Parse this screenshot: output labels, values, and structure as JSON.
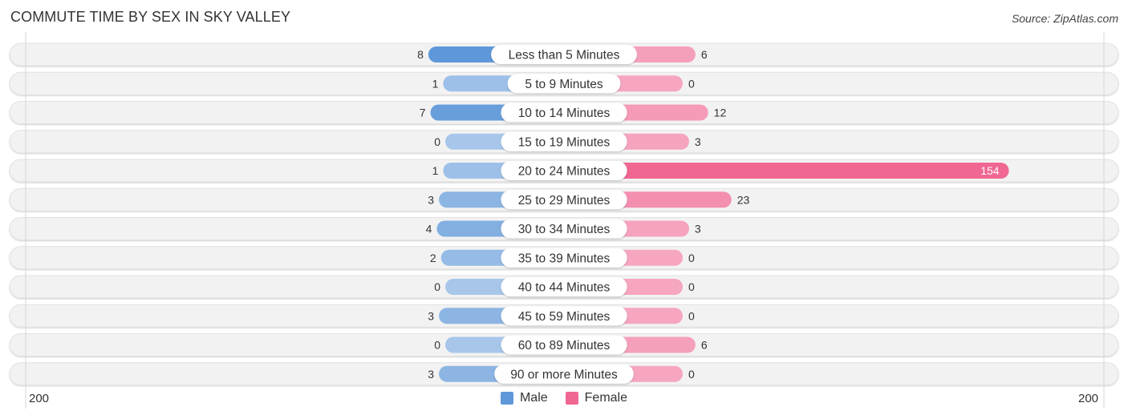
{
  "header": {
    "title": "COMMUTE TIME BY SEX IN SKY VALLEY",
    "source": "Source: ZipAtlas.com"
  },
  "colors": {
    "male_strong": "#5f98d8",
    "male_light": "#a7c6ea",
    "female_strong": "#f06792",
    "female_light": "#f6a6bf",
    "row_bg": "#f2f2f2"
  },
  "chart_data": {
    "type": "bar",
    "orientation": "horizontal-diverging",
    "title": "COMMUTE TIME BY SEX IN SKY VALLEY",
    "categories": [
      "Less than 5 Minutes",
      "5 to 9 Minutes",
      "10 to 14 Minutes",
      "15 to 19 Minutes",
      "20 to 24 Minutes",
      "25 to 29 Minutes",
      "30 to 34 Minutes",
      "35 to 39 Minutes",
      "40 to 44 Minutes",
      "45 to 59 Minutes",
      "60 to 89 Minutes",
      "90 or more Minutes"
    ],
    "series": [
      {
        "name": "Male",
        "values": [
          8,
          1,
          7,
          0,
          1,
          3,
          4,
          2,
          0,
          3,
          0,
          3
        ]
      },
      {
        "name": "Female",
        "values": [
          6,
          0,
          12,
          3,
          154,
          23,
          3,
          0,
          0,
          0,
          6,
          0
        ]
      }
    ],
    "xlim": [
      -200,
      200
    ],
    "axis_ticks": {
      "left": "200",
      "right": "200"
    },
    "legend": {
      "position": "bottom-center",
      "entries": [
        "Male",
        "Female"
      ]
    },
    "xlabel": "",
    "ylabel": ""
  }
}
